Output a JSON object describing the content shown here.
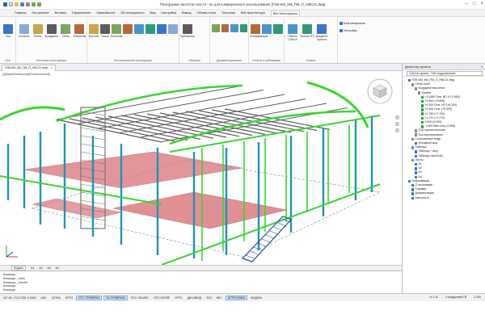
{
  "window": {
    "title": "Платформа nanoCAD x64 24 - не для коммерческого использования [ПЭК-КМ_КМ_ПМ_П_НВС21.dwg]"
  },
  "menu": [
    "Главная",
    "Построение",
    "Вставка",
    "Оформление",
    "Зависимости",
    "3D-инструменты",
    "Вид",
    "Настройки",
    "Вывод",
    "Облако точек",
    "Топоплан",
    "BIM Архитектура",
    "BIM Конструкции"
  ],
  "ribbon": {
    "groups": [
      {
        "name": "Оси",
        "buttons": [
          "Оси"
        ]
      },
      {
        "name": "Бетонные конструкции",
        "buttons": [
          "Колонна",
          "Балка",
          "Фундамент",
          "Стена",
          "Отверстие"
        ]
      },
      {
        "name": "Металлические конструкции",
        "buttons": [
          "Колонна",
          "Балка",
          "Пластина",
          "",
          "",
          "",
          "",
          ""
        ]
      },
      {
        "name": "Объекты",
        "buttons": [
          "Библиотека"
        ]
      },
      {
        "name": "Документирование",
        "buttons": [
          "",
          "",
          "",
          ""
        ]
      },
      {
        "name": "Отчеты и публикация",
        "buttons": [
          "Спецификация",
          "",
          ""
        ]
      },
      {
        "name": "Сервис",
        "buttons": [
          "Панель CADLib",
          "Экспорт IFC",
          "Документ проекта"
        ]
      }
    ],
    "side_buttons": [
      "База материалов",
      "Настройки..."
    ]
  },
  "document_tab": {
    "label": "ПЭК-КМ_КМ_ПМ_П_НВС21.dwg*"
  },
  "viewport": {
    "label": "[-][Верх/Изометрия][Реалистичный]"
  },
  "layout_tabs": [
    "Модель",
    "A1",
    "A2",
    "A3",
    "A4"
  ],
  "command_lines": [
    "Команда:",
    "Команда: _ortho",
    "Команда: _3dorbit",
    "Команда:",
    "Команда:"
  ],
  "status": {
    "coords": "427.49, 1713.7232, 0.0000",
    "items": [
      "ШАГ",
      "СЕТКА",
      "ОРТО",
      "ОТС-ПРИВЯЗКА",
      "3D-ПРИВЯЗКА",
      "ОТС-ОБЪЕКТ",
      "ОТС-ПОЛЯР",
      "ОРТО",
      "ДИН-ВВОД",
      "ТОЛ",
      "ВЕС",
      "ШТРИХОВКА",
      "МОДЕЛЬ"
    ],
    "on_items": [
      "ОТС-ПРИВЯЗКА",
      "3D-ПРИВЯЗКА",
      "ШТРИХОВКА"
    ],
    "scale": "m 1:10",
    "right_label": "Стандартный ПК",
    "zoom": "1:100"
  },
  "panel": {
    "title": "Диспетчер проекта",
    "project": "CADLib-проект: \"Нет подключения\"",
    "tree": [
      {
        "level": 0,
        "label": "ПЭК-КМ_КМ_ПМ_П_НВС21.dwg",
        "color": "#3a74c8",
        "expanded": true
      },
      {
        "level": 1,
        "label": "Сетки осей",
        "color": "#8a8a8a",
        "expanded": true
      },
      {
        "level": 2,
        "label": "Координатная сетка",
        "color": "#8a8a8a",
        "expanded": true
      },
      {
        "level": 3,
        "label": "Уровни",
        "color": "#8a8a8a",
        "expanded": true
      },
      {
        "level": 4,
        "label": "+12.850 Отм. ВП (+12.850)",
        "color": "#2b9a45"
      },
      {
        "level": 4,
        "label": "+9.800 (+9.800)",
        "color": "#2b9a45"
      },
      {
        "level": 4,
        "label": "+6.200 Отм. НП (+6.200)",
        "color": "#2b9a45"
      },
      {
        "level": 4,
        "label": "+5.300 Отм. (+5.300)",
        "color": "#2b9a45"
      },
      {
        "level": 4,
        "label": "+2.750 (+2.750)",
        "color": "#2b9a45"
      },
      {
        "level": 4,
        "label": "+1.270 (+1.270)",
        "color": "#2b9a45"
      },
      {
        "level": 4,
        "label": "0.000 (0.000)",
        "color": "#2b9a45"
      },
      {
        "level": 4,
        "label": "-0.500 Мин.отм (-0.500)",
        "color": "#2b9a45"
      },
      {
        "level": 2,
        "label": "Оси горизонтальные",
        "color": "#8a8a8a"
      },
      {
        "level": 2,
        "label": "Оси вертикальные",
        "color": "#8a8a8a"
      },
      {
        "level": 1,
        "label": "Сохраненные виды",
        "color": "#8a8a8a",
        "expanded": true
      },
      {
        "level": 2,
        "label": "Исходный вид",
        "color": "#3a74c8"
      },
      {
        "level": 1,
        "label": "Таблицы",
        "color": "#8a8a8a",
        "expanded": true
      },
      {
        "level": 2,
        "label": "Таблицы *.dwg",
        "color": "#3a74c8"
      },
      {
        "level": 2,
        "label": "Таблицы nanoCAD",
        "color": "#3a74c8"
      },
      {
        "level": 1,
        "label": "Листы",
        "color": "#8a8a8a",
        "expanded": true
      },
      {
        "level": 2,
        "label": "A1",
        "color": "#3a74c8"
      },
      {
        "level": 2,
        "label": "A2",
        "color": "#3a74c8"
      },
      {
        "level": 2,
        "label": "A3",
        "color": "#3a74c8"
      },
      {
        "level": 2,
        "label": "A4",
        "color": "#3a74c8"
      },
      {
        "level": 0,
        "label": "Информация",
        "color": "#3a74c8",
        "expanded": true
      },
      {
        "level": 1,
        "label": "О программе...",
        "color": "#3a74c8"
      },
      {
        "level": 1,
        "label": "Справка",
        "color": "#3a74c8"
      },
      {
        "level": 1,
        "label": "Документация",
        "color": "#3a74c8"
      },
      {
        "level": 1,
        "label": "nanocad.ru",
        "color": "#3a74c8"
      }
    ]
  },
  "colors": {
    "accent": "#3a74c8",
    "steel_green": "#39d62f",
    "steel_blue": "#1f93b8",
    "slab_red": "#d9747a",
    "beam_gray": "#5c5c5c"
  }
}
